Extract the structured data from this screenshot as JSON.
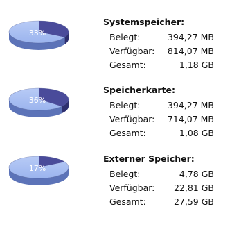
{
  "storage": [
    {
      "title": "Systemspeicher:",
      "percent_label": "33%",
      "used_fraction": 0.33,
      "rows": [
        {
          "label": "Belegt:",
          "value": "394,27 MB"
        },
        {
          "label": "Verfügbar:",
          "value": "814,07 MB"
        },
        {
          "label": "Gesamt:",
          "value": "1,18 GB"
        }
      ]
    },
    {
      "title": "Speicherkarte:",
      "percent_label": "36%",
      "used_fraction": 0.36,
      "rows": [
        {
          "label": "Belegt:",
          "value": "394,27 MB"
        },
        {
          "label": "Verfügbar:",
          "value": "714,07 MB"
        },
        {
          "label": "Gesamt:",
          "value": "1,08 GB"
        }
      ]
    },
    {
      "title": "Externer Speicher:",
      "percent_label": "17%",
      "used_fraction": 0.17,
      "rows": [
        {
          "label": "Belegt:",
          "value": "4,78 GB"
        },
        {
          "label": "Verfügbar:",
          "value": "22,81 GB"
        },
        {
          "label": "Gesamt:",
          "value": "27,59 GB"
        }
      ]
    }
  ],
  "colors": {
    "used_top": "#4a4b9a",
    "free_top": "#9bb4ee",
    "used_side": "#2e2f6e",
    "free_side": "#5c73b8"
  }
}
